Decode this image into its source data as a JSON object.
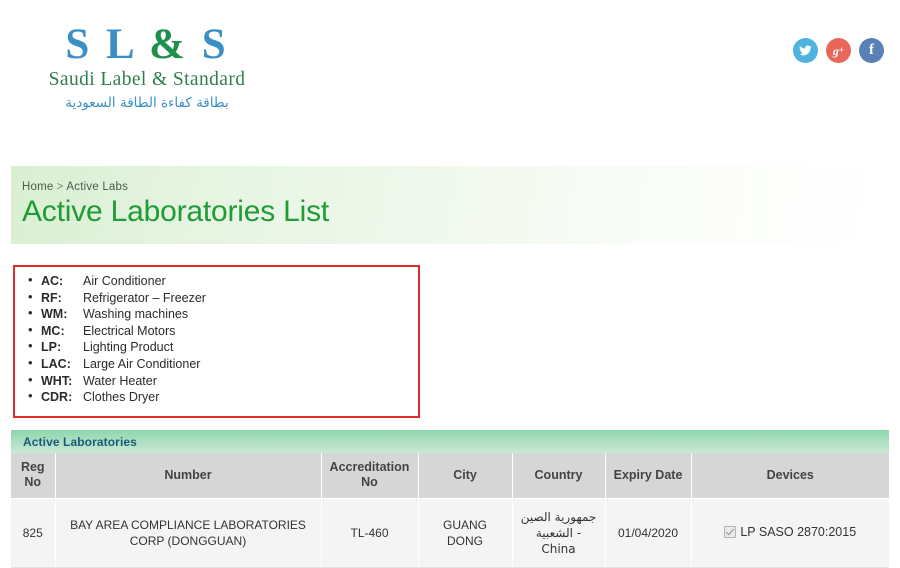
{
  "header": {
    "logo": {
      "line1_left": "S L",
      "line1_amp": "&",
      "line1_right": "S",
      "line2": "Saudi Label & Standard",
      "line3_ar": "بطاقة كفاءة الطاقة السعودية"
    },
    "social": [
      {
        "name": "twitter",
        "label": "Twitter",
        "color": "#4fb3e0",
        "glyph": "t"
      },
      {
        "name": "google-plus",
        "label": "Google Plus",
        "color": "#e8675a",
        "glyph": "g+"
      },
      {
        "name": "facebook",
        "label": "Facebook",
        "color": "#5a81b5",
        "glyph": "f"
      }
    ]
  },
  "banner": {
    "breadcrumb": {
      "home": "Home",
      "separator": ">",
      "current": "Active Labs"
    },
    "title": "Active Laboratories List"
  },
  "legend": {
    "border_color": "#e02b26",
    "items": [
      {
        "code": "AC:",
        "desc": "Air Conditioner"
      },
      {
        "code": "RF:",
        "desc": "Refrigerator – Freezer"
      },
      {
        "code": "WM:",
        "desc": "Washing machines"
      },
      {
        "code": "MC:",
        "desc": "Electrical Motors"
      },
      {
        "code": "LP:",
        "desc": "Lighting Product"
      },
      {
        "code": "LAC:",
        "desc": "Large Air Conditioner"
      },
      {
        "code": "WHT:",
        "desc": "Water Heater"
      },
      {
        "code": "CDR:",
        "desc": "Clothes Dryer"
      }
    ]
  },
  "table": {
    "panel_title": "Active Laboratories",
    "headers": {
      "reg_no": "Reg No",
      "number": "Number",
      "accreditation_no": "Accreditation No",
      "city": "City",
      "country": "Country",
      "expiry_date": "Expiry Date",
      "devices": "Devices"
    },
    "rows": [
      {
        "reg_no": "825",
        "number": "BAY AREA COMPLIANCE LABORATORIES CORP (DONGGUAN)",
        "accreditation_no": "TL-460",
        "city": "GUANG DONG",
        "country": "جمهورية الصين الشعبية - China",
        "expiry_date": "01/04/2020",
        "devices": "LP SASO 2870:2015",
        "devices_checked": true
      }
    ]
  }
}
